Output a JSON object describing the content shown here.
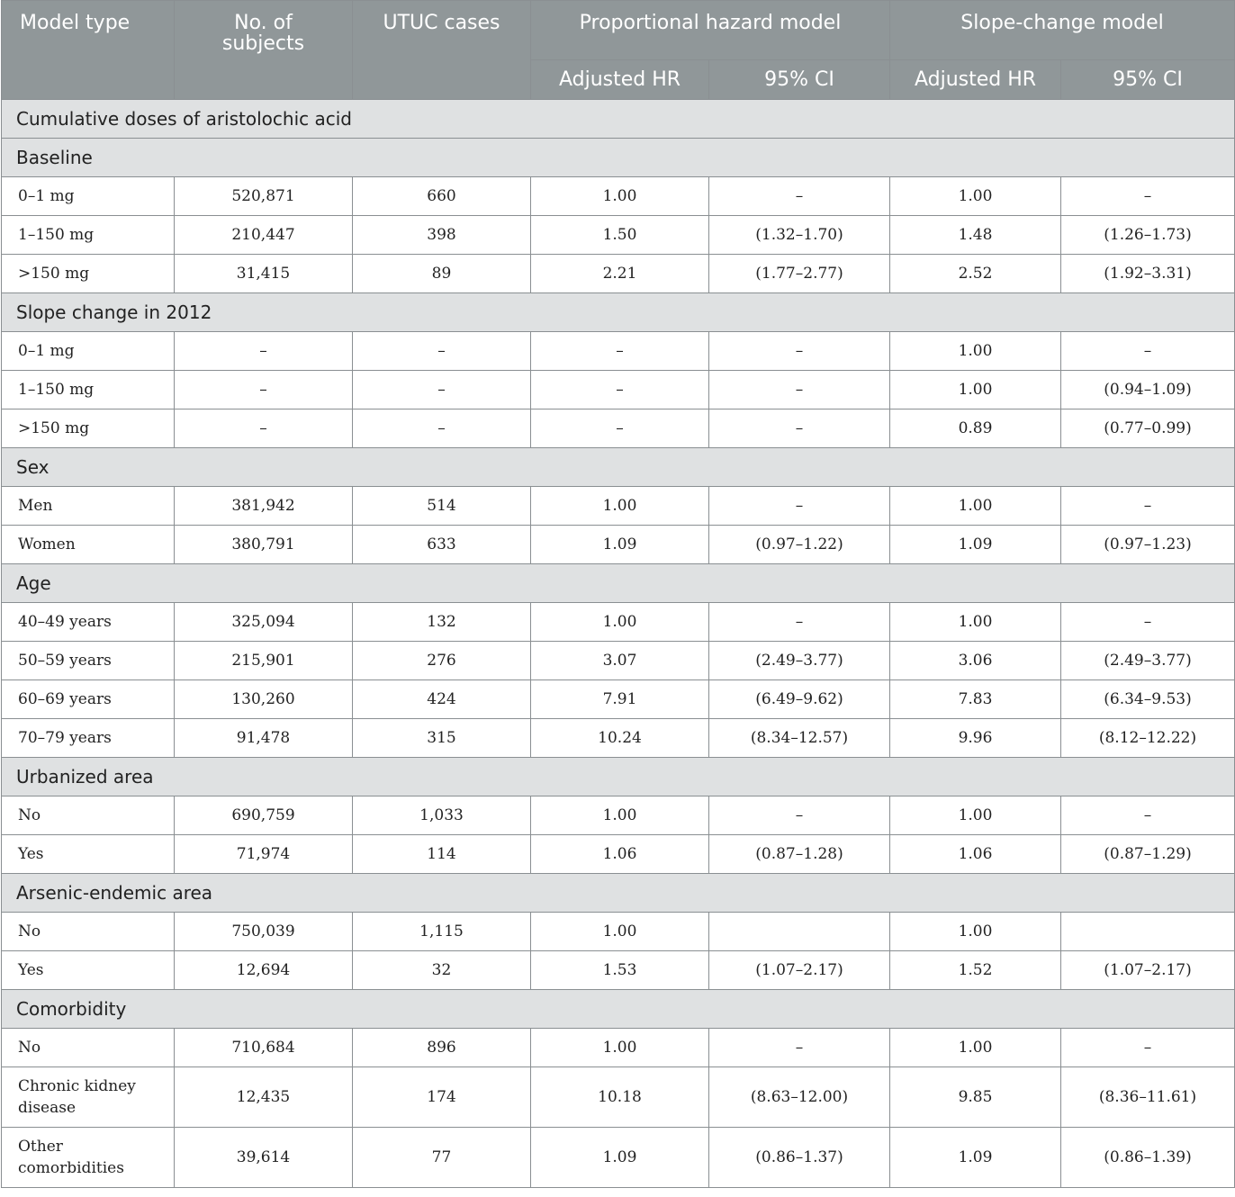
{
  "header": {
    "model_type": "Model type",
    "subjects": "No. of subjects",
    "utuc": "UTUC cases",
    "prop_model": "Proportional hazard model",
    "slope_model": "Slope-change model",
    "adj_hr": "Adjusted HR",
    "ci": "95% CI"
  },
  "sections": [
    {
      "title": "Cumulative doses of aristolochic acid",
      "rows": []
    },
    {
      "title": "Baseline",
      "rows": [
        {
          "label": "0–1 mg",
          "subjects": "520,871",
          "cases": "660",
          "p_hr": "1.00",
          "p_ci": "–",
          "s_hr": "1.00",
          "s_ci": "–"
        },
        {
          "label": "1–150 mg",
          "subjects": "210,447",
          "cases": "398",
          "p_hr": "1.50",
          "p_ci": "(1.32–1.70)",
          "s_hr": "1.48",
          "s_ci": "(1.26–1.73)"
        },
        {
          "label": ">150 mg",
          "subjects": "31,415",
          "cases": "89",
          "p_hr": "2.21",
          "p_ci": "(1.77–2.77)",
          "s_hr": "2.52",
          "s_ci": "(1.92–3.31)"
        }
      ]
    },
    {
      "title": "Slope change in 2012",
      "rows": [
        {
          "label": "0–1 mg",
          "subjects": "–",
          "cases": "–",
          "p_hr": "–",
          "p_ci": "–",
          "s_hr": "1.00",
          "s_ci": "–"
        },
        {
          "label": "1–150 mg",
          "subjects": "–",
          "cases": "–",
          "p_hr": "–",
          "p_ci": "–",
          "s_hr": "1.00",
          "s_ci": "(0.94–1.09)"
        },
        {
          "label": ">150 mg",
          "subjects": "–",
          "cases": "–",
          "p_hr": "–",
          "p_ci": "–",
          "s_hr": "0.89",
          "s_ci": "(0.77–0.99)"
        }
      ]
    },
    {
      "title": "Sex",
      "rows": [
        {
          "label": "Men",
          "subjects": "381,942",
          "cases": "514",
          "p_hr": "1.00",
          "p_ci": "–",
          "s_hr": "1.00",
          "s_ci": "–"
        },
        {
          "label": "Women",
          "subjects": "380,791",
          "cases": "633",
          "p_hr": "1.09",
          "p_ci": "(0.97–1.22)",
          "s_hr": "1.09",
          "s_ci": "(0.97–1.23)"
        }
      ]
    },
    {
      "title": "Age",
      "rows": [
        {
          "label": "40–49 years",
          "subjects": "325,094",
          "cases": "132",
          "p_hr": "1.00",
          "p_ci": "–",
          "s_hr": "1.00",
          "s_ci": "–"
        },
        {
          "label": "50–59 years",
          "subjects": "215,901",
          "cases": "276",
          "p_hr": "3.07",
          "p_ci": "(2.49–3.77)",
          "s_hr": "3.06",
          "s_ci": "(2.49–3.77)"
        },
        {
          "label": "60–69 years",
          "subjects": "130,260",
          "cases": "424",
          "p_hr": "7.91",
          "p_ci": "(6.49–9.62)",
          "s_hr": "7.83",
          "s_ci": "(6.34–9.53)"
        },
        {
          "label": "70–79 years",
          "subjects": "91,478",
          "cases": "315",
          "p_hr": "10.24",
          "p_ci": "(8.34–12.57)",
          "s_hr": "9.96",
          "s_ci": "(8.12–12.22)"
        }
      ]
    },
    {
      "title": "Urbanized area",
      "rows": [
        {
          "label": "No",
          "subjects": "690,759",
          "cases": "1,033",
          "p_hr": "1.00",
          "p_ci": "–",
          "s_hr": "1.00",
          "s_ci": "–"
        },
        {
          "label": "Yes",
          "subjects": "71,974",
          "cases": "114",
          "p_hr": "1.06",
          "p_ci": "(0.87–1.28)",
          "s_hr": "1.06",
          "s_ci": "(0.87–1.29)"
        }
      ]
    },
    {
      "title": "Arsenic-endemic area",
      "rows": [
        {
          "label": "No",
          "subjects": "750,039",
          "cases": "1,115",
          "p_hr": "1.00",
          "p_ci": "",
          "s_hr": "1.00",
          "s_ci": ""
        },
        {
          "label": "Yes",
          "subjects": "12,694",
          "cases": "32",
          "p_hr": "1.53",
          "p_ci": "(1.07–2.17)",
          "s_hr": "1.52",
          "s_ci": "(1.07–2.17)"
        }
      ]
    },
    {
      "title": "Comorbidity",
      "rows": [
        {
          "label": "No",
          "subjects": "710,684",
          "cases": "896",
          "p_hr": "1.00",
          "p_ci": "–",
          "s_hr": "1.00",
          "s_ci": "–"
        },
        {
          "label": "Chronic kidney disease",
          "subjects": "12,435",
          "cases": "174",
          "p_hr": "10.18",
          "p_ci": "(8.63–12.00)",
          "s_hr": "9.85",
          "s_ci": "(8.36–11.61)",
          "tall": true
        },
        {
          "label": "Other comorbidities",
          "subjects": "39,614",
          "cases": "77",
          "p_hr": "1.09",
          "p_ci": "(0.86–1.37)",
          "s_hr": "1.09",
          "s_ci": "(0.86–1.39)",
          "tall": true
        }
      ]
    }
  ]
}
